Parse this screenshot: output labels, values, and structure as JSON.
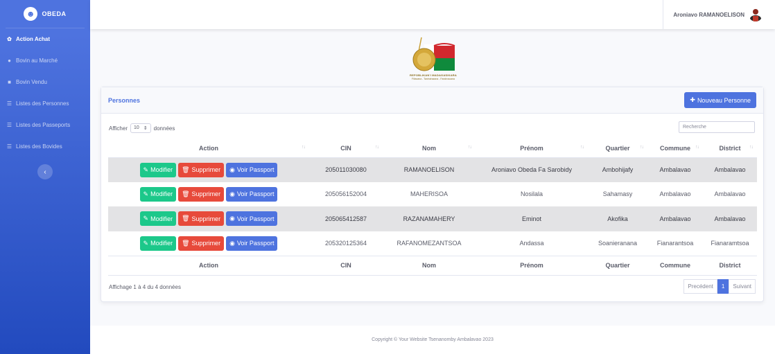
{
  "brand": {
    "name": "OBEDA",
    "icon": "smile-icon"
  },
  "sidebar": {
    "items": [
      {
        "label": "Action Achat",
        "icon": "cog-icon",
        "active": true
      },
      {
        "label": "Bovin au Marché",
        "icon": "map-marker-icon",
        "active": false
      },
      {
        "label": "Bovin Vendu",
        "icon": "truck-icon",
        "active": false
      },
      {
        "label": "Listes des Personnes",
        "icon": "list-icon",
        "active": false
      },
      {
        "label": "Listes des Passeports",
        "icon": "list-icon",
        "active": false
      },
      {
        "label": "Listes des Bovides",
        "icon": "list-icon",
        "active": false
      }
    ],
    "toggle_glyph": "‹"
  },
  "topbar": {
    "user_name": "Aroniavo RAMANOELISON"
  },
  "logo": {
    "line1": "REPOBLIKAN'I MADAGASIKARA",
    "line2": "Fitiavana - Tanindrazana - Fandrosoana"
  },
  "card": {
    "title": "Personnes",
    "new_button": "Nouveau Personne",
    "show_prefix": "Afficher",
    "show_value": "10",
    "show_suffix": "données",
    "search_placeholder": "Recherche",
    "columns": [
      "Action",
      "CIN",
      "Nom",
      "Prénom",
      "Quartier",
      "Commune",
      "District"
    ],
    "row_buttons": {
      "edit": "Modifier",
      "delete": "Supprimer",
      "passport": "Voir Passport"
    },
    "rows": [
      {
        "cin": "205011030080",
        "nom": "RAMANOELISON",
        "prenom": "Aroniavo Obeda Fa Sarobidy",
        "quartier": "Ambohijafy",
        "commune": "Ambalavao",
        "district": "Ambalavao"
      },
      {
        "cin": "205056152004",
        "nom": "MAHERISOA",
        "prenom": "Nosilala",
        "quartier": "Sahamasy",
        "commune": "Ambalavao",
        "district": "Ambalavao"
      },
      {
        "cin": "205065412587",
        "nom": "RAZANAMAHERY",
        "prenom": "Eminot",
        "quartier": "Akofika",
        "commune": "Ambalavao",
        "district": "Ambalavao"
      },
      {
        "cin": "205320125364",
        "nom": "RAFANOMEZANTSOA",
        "prenom": "Andassa",
        "quartier": "Soanieranana",
        "commune": "Fianarantsoa",
        "district": "Fianaramtsoa"
      }
    ],
    "info": "Affichage 1 à 4 du 4 données",
    "pagination": {
      "prev": "Precédent",
      "current": "1",
      "next": "Suivant"
    }
  },
  "footer": {
    "text": "Copyright © Your Website Tsenanomby Ambalavao 2023"
  },
  "colors": {
    "primary": "#4e73df",
    "success": "#1cc88a",
    "danger": "#e74a3b"
  }
}
